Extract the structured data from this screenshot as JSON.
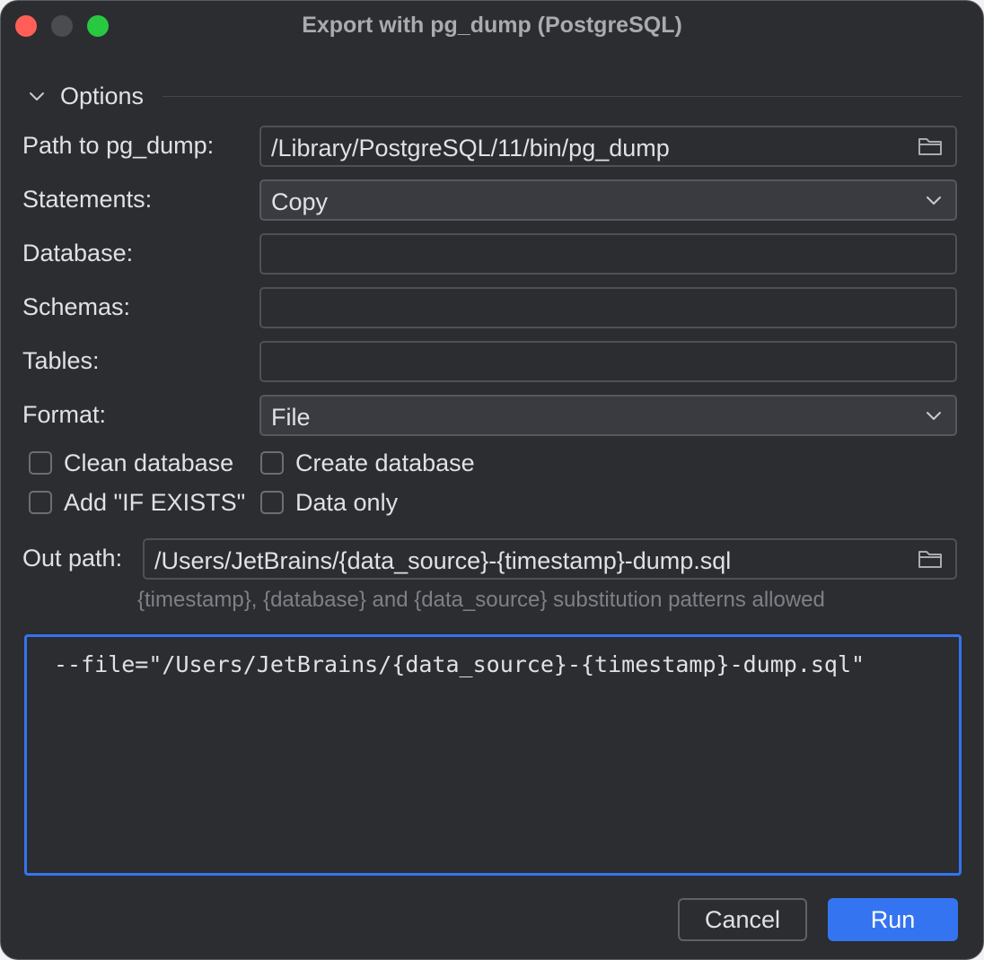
{
  "window": {
    "title": "Export with pg_dump (PostgreSQL)"
  },
  "options": {
    "section_label": "Options",
    "path_label": "Path to pg_dump:",
    "path_value": "/Library/PostgreSQL/11/bin/pg_dump",
    "statements_label": "Statements:",
    "statements_value": "Copy",
    "database_label": "Database:",
    "database_value": "",
    "schemas_label": "Schemas:",
    "schemas_value": "",
    "tables_label": "Tables:",
    "tables_value": "",
    "format_label": "Format:",
    "format_value": "File",
    "checkboxes": {
      "clean_database": {
        "label": "Clean database",
        "checked": false
      },
      "create_database": {
        "label": "Create database",
        "checked": false
      },
      "add_if_exists": {
        "label": "Add \"IF EXISTS\"",
        "checked": false
      },
      "data_only": {
        "label": "Data only",
        "checked": false
      }
    },
    "out_path_label": "Out path:",
    "out_path_value": "/Users/JetBrains/{data_source}-{timestamp}-dump.sql",
    "out_path_hint": "{timestamp}, {database} and {data_source} substitution patterns allowed"
  },
  "command_preview": {
    "text": "--file=\"/Users/JetBrains/{data_source}-{timestamp}-dump.sql\""
  },
  "buttons": {
    "cancel": "Cancel",
    "run": "Run"
  },
  "colors": {
    "background": "#2b2d30",
    "accent": "#3574f0",
    "text": "#dfe1e5",
    "hint": "#7e8087"
  },
  "icons": {
    "folder": "folder-icon",
    "dropdown": "chevron-down-icon",
    "section_toggle": "chevron-down-icon"
  }
}
